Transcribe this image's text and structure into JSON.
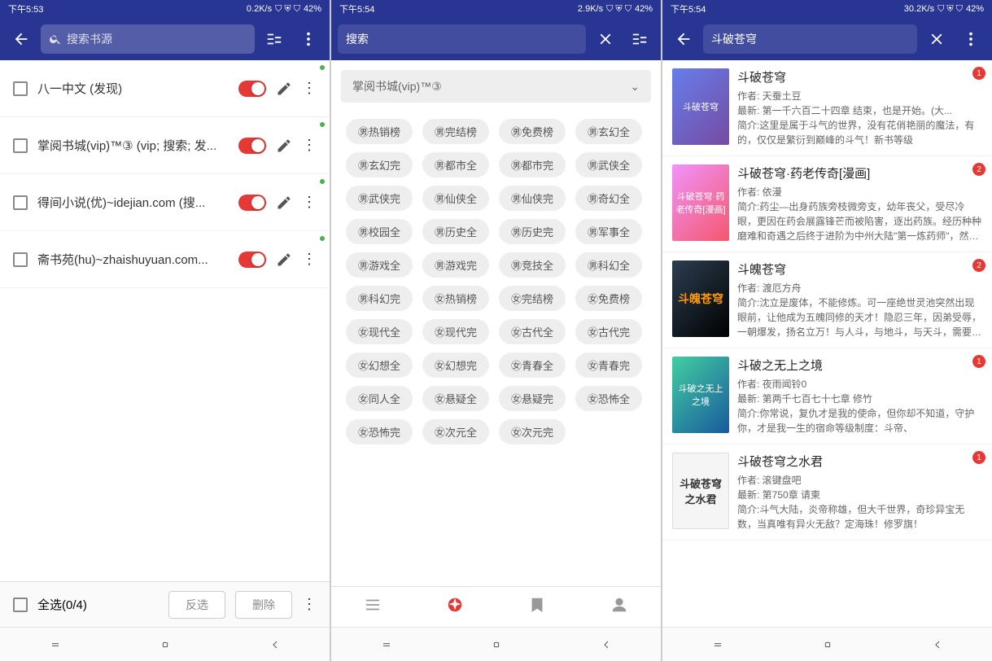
{
  "screen1": {
    "status": {
      "time": "下午5:53",
      "speed": "0.2K/s",
      "battery": "42%"
    },
    "search_placeholder": "搜索书源",
    "sources": [
      {
        "label": "八一中文 (发现)"
      },
      {
        "label": "掌阅书城(vip)™③ (vip; 搜索; 发..."
      },
      {
        "label": "得间小说(优)~idejian.com (搜..."
      },
      {
        "label": "斋书苑(hu)~zhaishuyuan.com..."
      }
    ],
    "footer": {
      "select_all": "全选(0/4)",
      "invert": "反选",
      "delete": "删除"
    }
  },
  "screen2": {
    "status": {
      "time": "下午5:54",
      "speed": "2.9K/s",
      "battery": "42%"
    },
    "search_label": "搜索",
    "dropdown": "掌阅书城(vip)™③",
    "tags": [
      "㊚热销榜",
      "㊚完结榜",
      "㊚免费榜",
      "㊚玄幻全",
      "㊚玄幻完",
      "㊚都市全",
      "㊚都市完",
      "㊚武侠全",
      "㊚武侠完",
      "㊚仙侠全",
      "㊚仙侠完",
      "㊚奇幻全",
      "㊚校园全",
      "㊚历史全",
      "㊚历史完",
      "㊚军事全",
      "㊚游戏全",
      "㊚游戏完",
      "㊚竞技全",
      "㊚科幻全",
      "㊚科幻完",
      "㊛热销榜",
      "㊛完结榜",
      "㊛免费榜",
      "㊛现代全",
      "㊛现代完",
      "㊛古代全",
      "㊛古代完",
      "㊛幻想全",
      "㊛幻想完",
      "㊛青春全",
      "㊛青春完",
      "㊛同人全",
      "㊛悬疑全",
      "㊛悬疑完",
      "㊛恐怖全",
      "㊛恐怖完",
      "㊛次元全",
      "㊛次元完"
    ]
  },
  "screen3": {
    "status": {
      "time": "下午5:54",
      "speed": "30.2K/s",
      "battery": "42%"
    },
    "query": "斗破苍穹",
    "results": [
      {
        "title": "斗破苍穹",
        "author": "作者: 天蚕土豆",
        "latest": "最新: 第一千六百二十四章 结束，也是开始。(大...",
        "desc": "简介:这里是属于斗气的世界，没有花俏艳丽的魔法，有的，仅仅是繁衍到巅峰的斗气！新书等级",
        "badge": "1"
      },
      {
        "title": "斗破苍穹·药老传奇[漫画]",
        "author": "作者: 依漫",
        "desc": "简介:药尘—出身药族旁枝微旁支，幼年丧父，受尽冷眼，更因在药会展露锋芒而被陷害，逐出药族。经历种种磨难和奇遇之后终于进阶为中州大陆\"第一炼药师\"，然而却因为徒弟的背叛而尸骨无存...",
        "badge": "2"
      },
      {
        "title": "斗魄苍穹",
        "author": "作者: 渡厄方舟",
        "desc": "简介:沈立是废体，不能修炼。可一座绝世灵池突然出现眼前，让他成为五魄同修的天才！隐忍三年，因弟受辱，一朝爆发，扬名立万！与人斗，与地斗，与天斗，需要魄力无尽，才能斗破苍穹。",
        "badge": "2"
      },
      {
        "title": "斗破之无上之境",
        "author": "作者: 夜雨闻铃0",
        "latest": "最新: 第两千七百七十七章 修竹",
        "desc": "简介:你常说，复仇才是我的使命，但你却不知道，守护你，才是我一生的宿命等级制度：斗帝、",
        "badge": "1"
      },
      {
        "title": "斗破苍穹之水君",
        "author": "作者: 滚键盘吧",
        "latest": "最新: 第750章 请柬",
        "desc": "简介:斗气大陆，炎帝称雄，但大千世界，奇珍异宝无数，当真唯有异火无敌？定海珠！修罗旗！",
        "badge": "1"
      }
    ]
  }
}
